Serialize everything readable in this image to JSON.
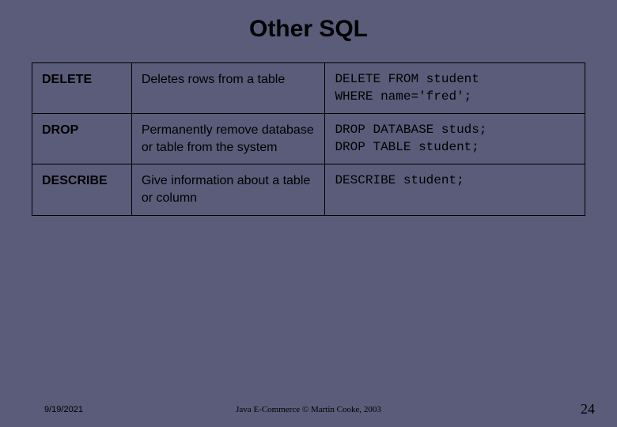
{
  "title": "Other SQL",
  "table": {
    "rows": [
      {
        "command": "DELETE",
        "description": "Deletes rows from a table",
        "example": "DELETE FROM student\nWHERE name='fred';"
      },
      {
        "command": "DROP",
        "description": "Permanently remove database or table from the system",
        "example": "DROP DATABASE studs;\nDROP TABLE student;"
      },
      {
        "command": "DESCRIBE",
        "description": "Give information about a table or column",
        "example": "DESCRIBE student;"
      }
    ]
  },
  "footer": {
    "date": "9/19/2021",
    "credit": "Java E-Commerce © Martin Cooke, 2003",
    "page": "24"
  }
}
